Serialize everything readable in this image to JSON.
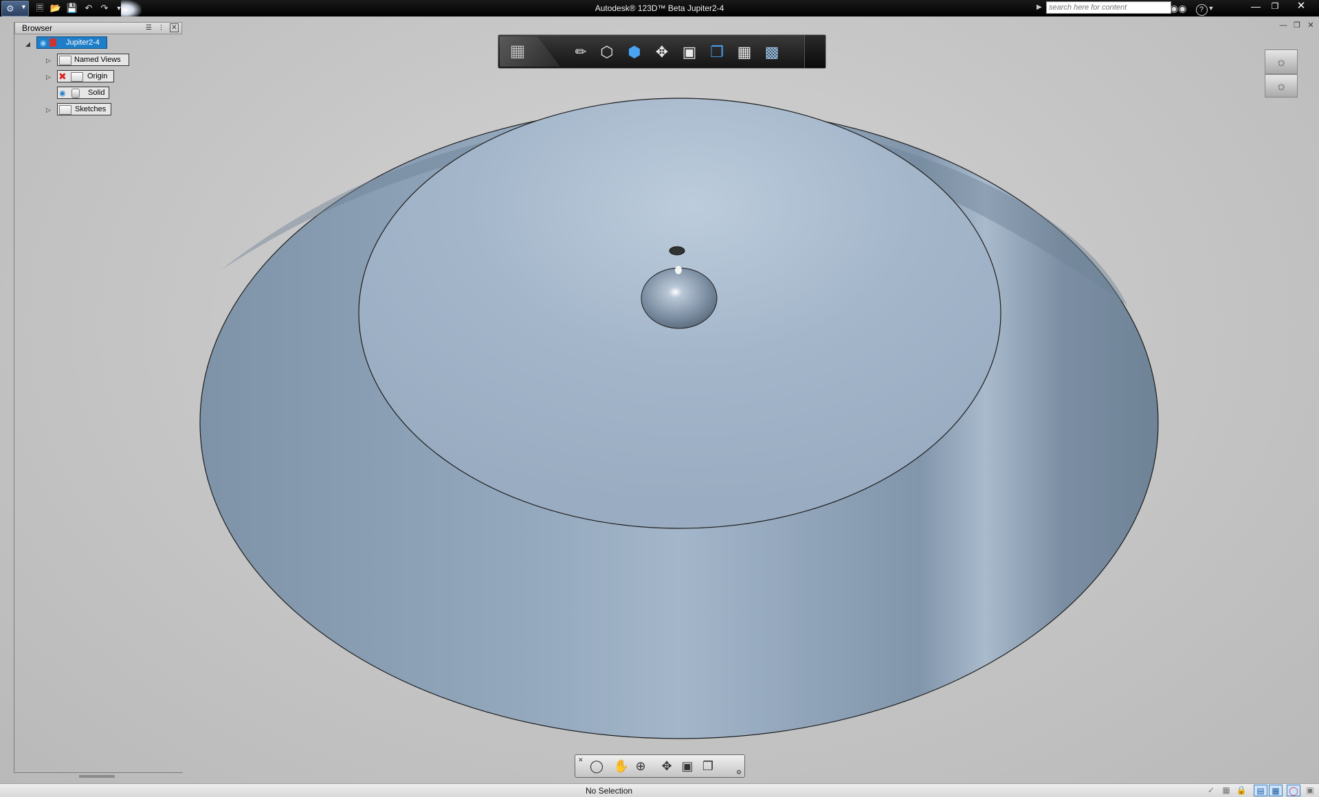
{
  "titlebar": {
    "title": "Autodesk® 123D™ Beta    Jupiter2-4",
    "search_placeholder": "search here for content",
    "qat_icons": [
      "new-file-icon",
      "open-file-icon",
      "save-icon",
      "undo-icon",
      "redo-icon",
      "customize-dropdown-icon"
    ]
  },
  "browser": {
    "title": "Browser",
    "root": "Jupiter2-4",
    "items": [
      {
        "label": "Named Views",
        "icon": "folder-icon",
        "expandable": true
      },
      {
        "label": "Origin",
        "icon": "folder-icon",
        "expandable": true
      },
      {
        "label": "Solid",
        "icon": "solid-body-icon",
        "expandable": false
      },
      {
        "label": "Sketches",
        "icon": "folder-icon",
        "expandable": true
      }
    ]
  },
  "view_toolbar": {
    "buttons": [
      "home-view-icon",
      "sketch-pencil-icon",
      "box-primitive-icon",
      "extrude-icon",
      "move-icon",
      "press-pull-icon",
      "shell-icon",
      "pattern-icon",
      "grouping-icon"
    ]
  },
  "navbar": {
    "buttons": [
      "orbit-icon",
      "pan-icon",
      "zoom-icon",
      "look-at-icon",
      "fit-icon",
      "view-cube-dropdown-icon"
    ]
  },
  "status": {
    "text": "No Selection"
  },
  "colors": {
    "titlebar": "#000000",
    "selection": "#1f7ec8",
    "model_surface": "#8fa3b8",
    "model_top": "#a6b8cc",
    "viewport_bg": "#c9c9c9"
  }
}
